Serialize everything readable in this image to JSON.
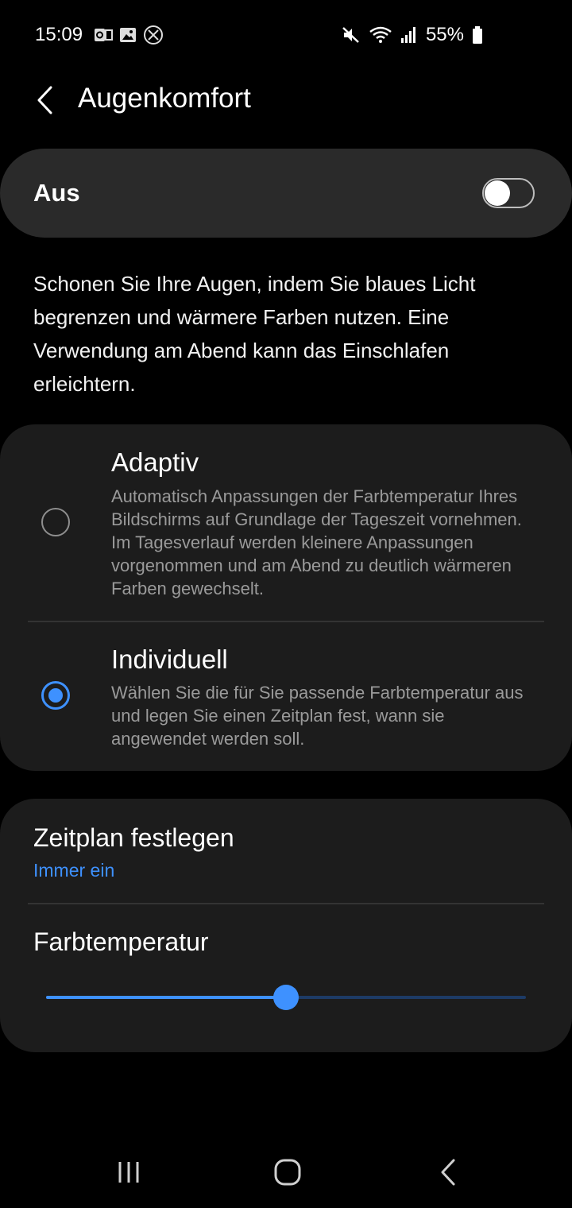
{
  "status_bar": {
    "time": "15:09",
    "battery_percent": "55%",
    "left_icons": [
      "outlook-icon",
      "gallery-icon",
      "x-icon"
    ],
    "right_icons": [
      "mute-icon",
      "wifi-icon",
      "signal-icon",
      "battery-icon"
    ]
  },
  "header": {
    "title": "Augenkomfort"
  },
  "master": {
    "label": "Aus",
    "enabled": false
  },
  "description": "Schonen Sie Ihre Augen, indem Sie blaues Licht begrenzen und wärmere Farben nutzen. Eine Verwendung am Abend kann das Einschlafen erleichtern.",
  "modes": [
    {
      "title": "Adaptiv",
      "description": "Automatisch Anpassungen der Farbtemperatur Ihres Bildschirms auf Grundlage der Tageszeit vornehmen. Im Tagesverlauf werden kleinere Anpassungen vorgenommen und am Abend zu deutlich wärmeren Farben gewechselt.",
      "selected": false
    },
    {
      "title": "Individuell",
      "description": "Wählen Sie die für Sie passende Farbtemperatur aus und legen Sie einen Zeitplan fest, wann sie angewendet werden soll.",
      "selected": true
    }
  ],
  "schedule": {
    "title": "Zeitplan festlegen",
    "value": "Immer ein"
  },
  "color_temperature": {
    "title": "Farbtemperatur",
    "level": 0.5
  },
  "colors": {
    "accent": "#3e91ff",
    "card": "#1c1c1c",
    "toggle_card": "#2a2a2a",
    "background": "#000000"
  }
}
